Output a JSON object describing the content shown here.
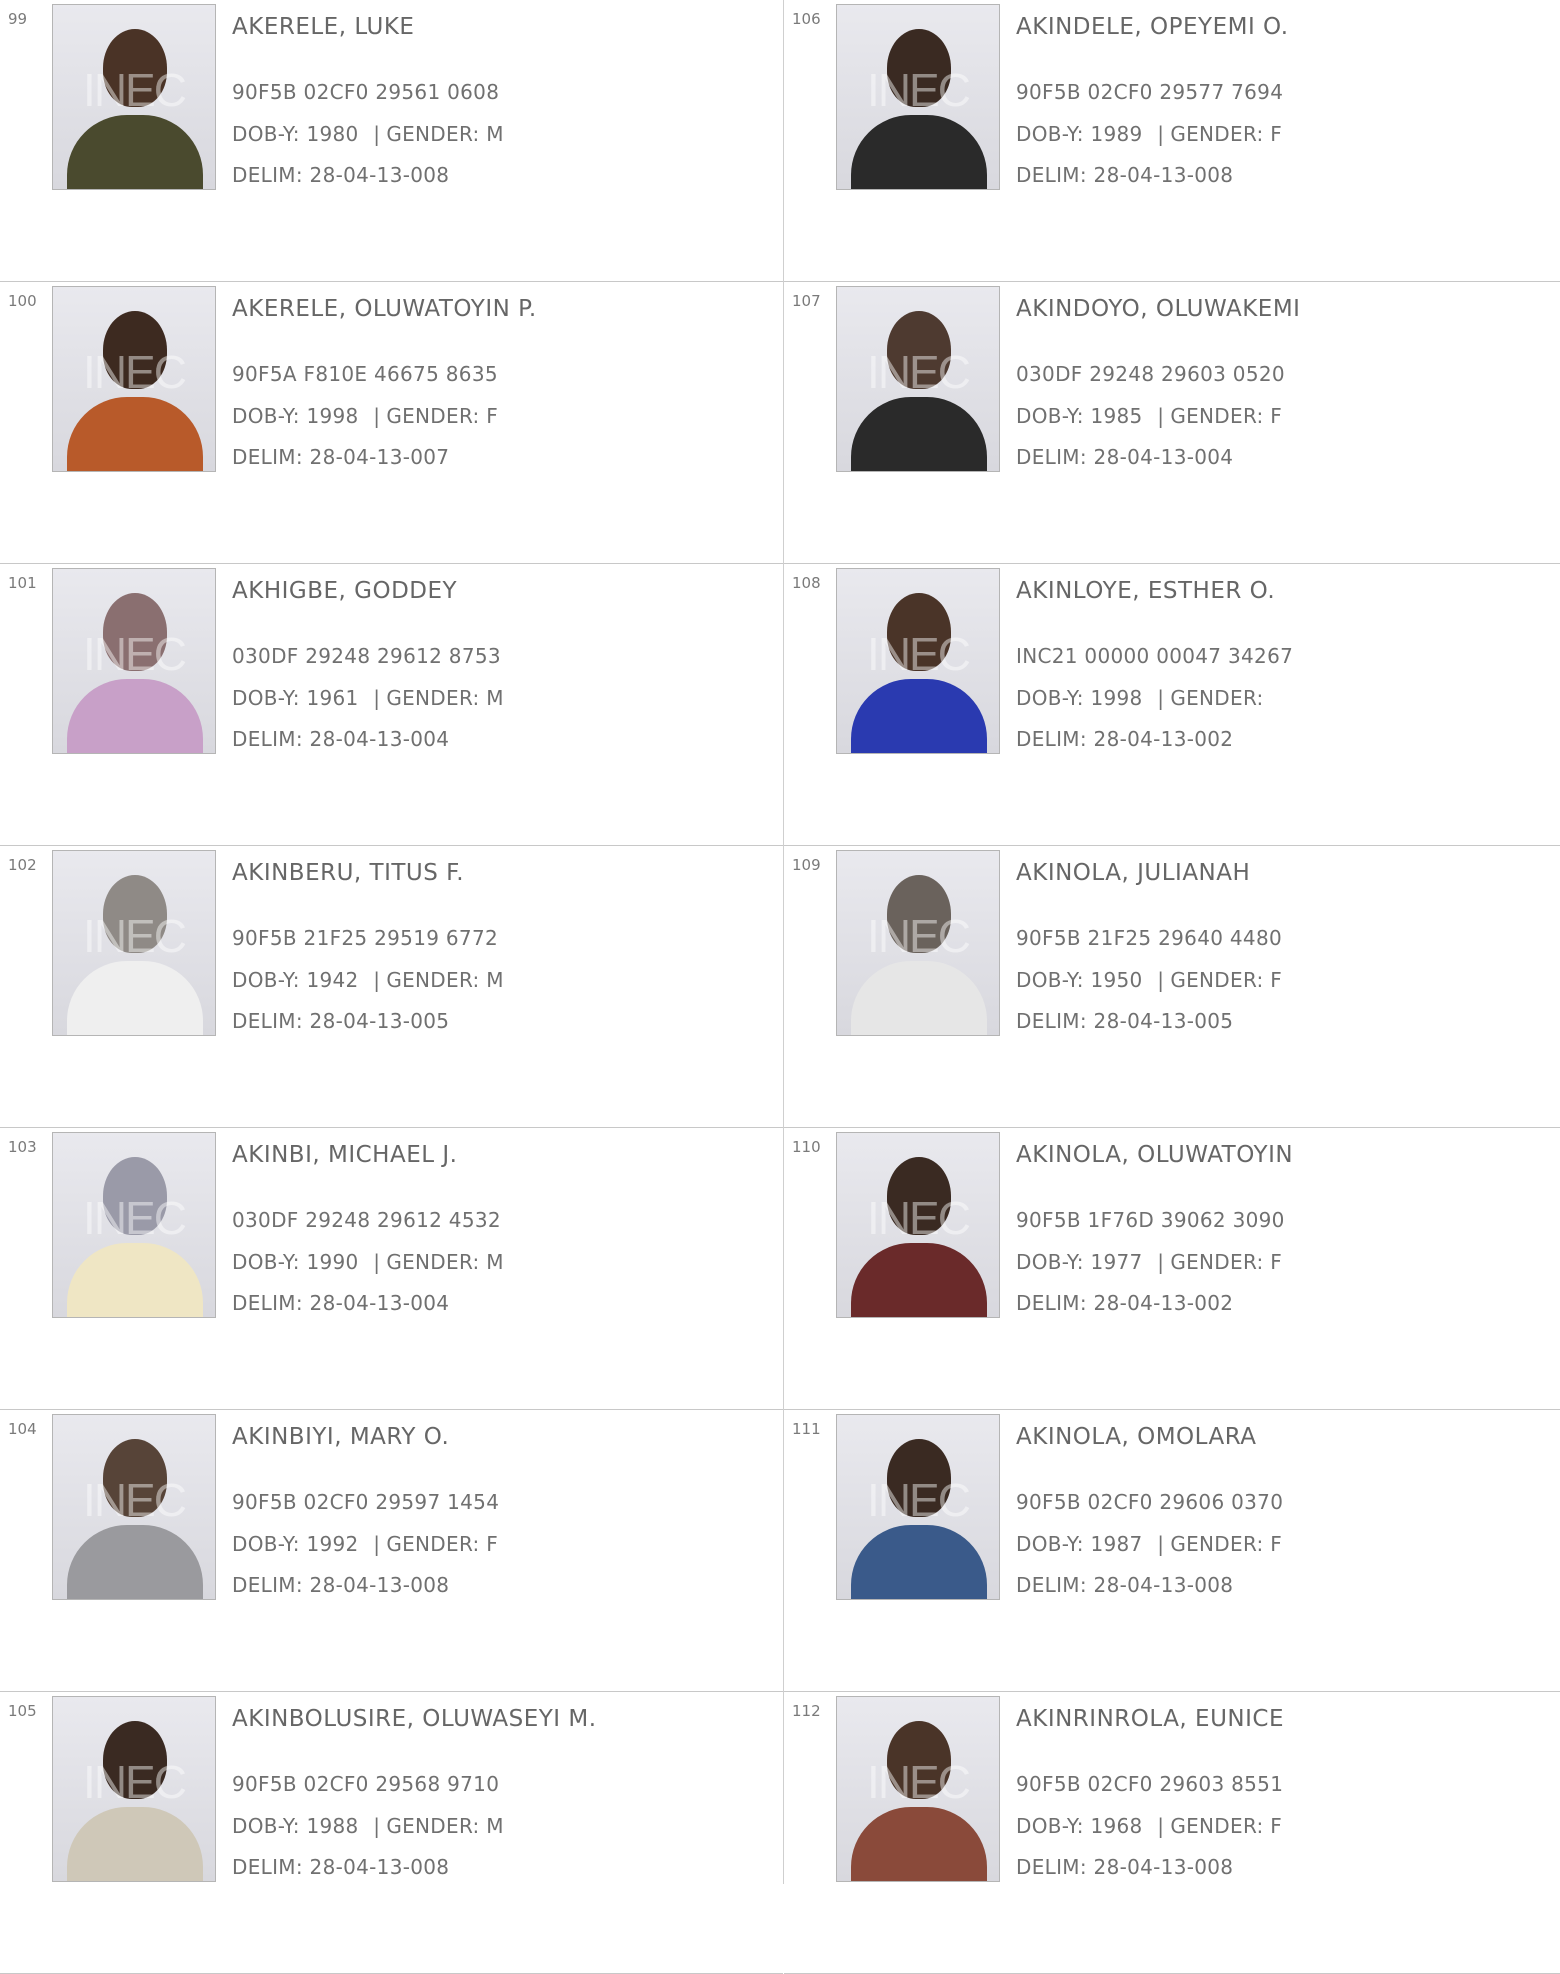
{
  "watermark": "INEC",
  "labels": {
    "dob": "DOB-Y:",
    "gender": "GENDER:",
    "delim": "DELIM:",
    "separator": "|"
  },
  "left_column": [
    {
      "num": "99",
      "name": "AKERELE, LUKE",
      "vin": "90F5B 02CF0 29561 0608",
      "dob": "1980",
      "gender": "M",
      "delim": "28-04-13-008",
      "skin": "#4a3326",
      "cloth": "#4a4a2e"
    },
    {
      "num": "100",
      "name": "AKERELE, OLUWATOYIN P.",
      "vin": "90F5A F810E 46675 8635",
      "dob": "1998",
      "gender": "F",
      "delim": "28-04-13-007",
      "skin": "#3d2a20",
      "cloth": "#b85a2a"
    },
    {
      "num": "101",
      "name": "AKHIGBE, GODDEY",
      "vin": "030DF 29248 29612 8753",
      "dob": "1961",
      "gender": "M",
      "delim": "28-04-13-004",
      "skin": "#8a6f70",
      "cloth": "#c8a0c8"
    },
    {
      "num": "102",
      "name": "AKINBERU, TITUS F.",
      "vin": "90F5B 21F25 29519 6772",
      "dob": "1942",
      "gender": "M",
      "delim": "28-04-13-005",
      "skin": "#8f8a86",
      "cloth": "#efefef"
    },
    {
      "num": "103",
      "name": "AKINBI, MICHAEL J.",
      "vin": "030DF 29248 29612 4532",
      "dob": "1990",
      "gender": "M",
      "delim": "28-04-13-004",
      "skin": "#9a9aa8",
      "cloth": "#efe6c4"
    },
    {
      "num": "104",
      "name": "AKINBIYI, MARY O.",
      "vin": "90F5B 02CF0 29597 1454",
      "dob": "1992",
      "gender": "F",
      "delim": "28-04-13-008",
      "skin": "#574438",
      "cloth": "#9a9a9e"
    },
    {
      "num": "105",
      "name": "AKINBOLUSIRE, OLUWASEYI M.",
      "vin": "90F5B 02CF0 29568 9710",
      "dob": "1988",
      "gender": "M",
      "delim": "28-04-13-008",
      "skin": "#3a2a22",
      "cloth": "#cfc8b8"
    }
  ],
  "right_column": [
    {
      "num": "106",
      "name": "AKINDELE, OPEYEMI O.",
      "vin": "90F5B 02CF0 29577 7694",
      "dob": "1989",
      "gender": "F",
      "delim": "28-04-13-008",
      "skin": "#3a2a22",
      "cloth": "#2a2a2a"
    },
    {
      "num": "107",
      "name": "AKINDOYO, OLUWAKEMI",
      "vin": "030DF 29248 29603 0520",
      "dob": "1985",
      "gender": "F",
      "delim": "28-04-13-004",
      "skin": "#4e3a30",
      "cloth": "#2a2a2a"
    },
    {
      "num": "108",
      "name": "AKINLOYE, ESTHER O.",
      "vin": "INC21 00000 00047 34267",
      "dob": "1998",
      "gender": "",
      "delim": "28-04-13-002",
      "skin": "#4a3428",
      "cloth": "#2a3ab0"
    },
    {
      "num": "109",
      "name": "AKINOLA, JULIANAH",
      "vin": "90F5B 21F25 29640 4480",
      "dob": "1950",
      "gender": "F",
      "delim": "28-04-13-005",
      "skin": "#6a625c",
      "cloth": "#e6e6e6"
    },
    {
      "num": "110",
      "name": "AKINOLA, OLUWATOYIN",
      "vin": "90F5B 1F76D 39062 3090",
      "dob": "1977",
      "gender": "F",
      "delim": "28-04-13-002",
      "skin": "#3a2a22",
      "cloth": "#6a2a2a"
    },
    {
      "num": "111",
      "name": "AKINOLA, OMOLARA",
      "vin": "90F5B 02CF0 29606 0370",
      "dob": "1987",
      "gender": "F",
      "delim": "28-04-13-008",
      "skin": "#3a2a22",
      "cloth": "#3a5a8a"
    },
    {
      "num": "112",
      "name": "AKINRINROLA, EUNICE",
      "vin": "90F5B 02CF0 29603 8551",
      "dob": "1968",
      "gender": "F",
      "delim": "28-04-13-008",
      "skin": "#4a3428",
      "cloth": "#8a4a3a"
    }
  ]
}
